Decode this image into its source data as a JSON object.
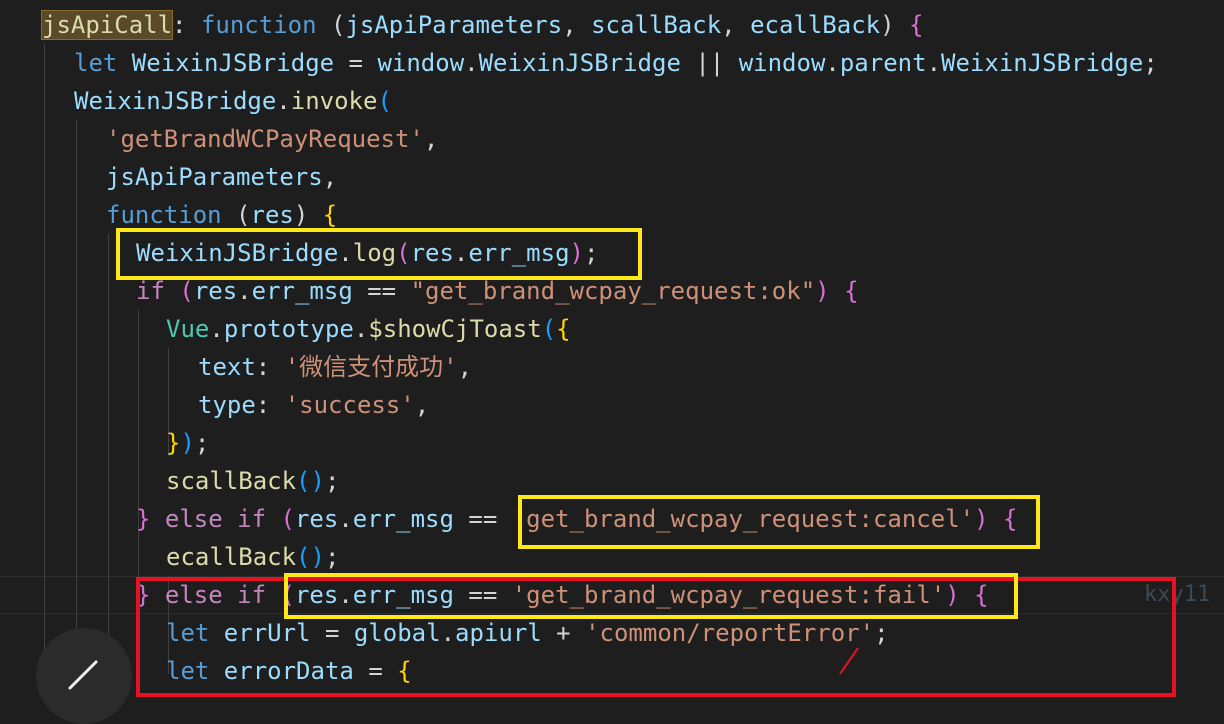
{
  "lines": [
    [
      {
        "t": "jsApiCall",
        "c": "#dcdcaa",
        "hl": true
      },
      {
        "t": ": ",
        "c": "#d4d4d4"
      },
      {
        "t": "function",
        "c": "#569cd6"
      },
      {
        "t": " (",
        "c": "#d4d4d4"
      },
      {
        "t": "jsApiParameters",
        "c": "#9cdcfe"
      },
      {
        "t": ", ",
        "c": "#d4d4d4"
      },
      {
        "t": "scallBack",
        "c": "#9cdcfe"
      },
      {
        "t": ", ",
        "c": "#d4d4d4"
      },
      {
        "t": "ecallBack",
        "c": "#9cdcfe"
      },
      {
        "t": ") ",
        "c": "#d4d4d4"
      },
      {
        "t": "{",
        "c": "#da70d6"
      }
    ],
    [
      {
        "t": "let",
        "c": "#569cd6"
      },
      {
        "t": " WeixinJSBridge ",
        "c": "#9cdcfe"
      },
      {
        "t": "= ",
        "c": "#d4d4d4"
      },
      {
        "t": "window",
        "c": "#9cdcfe"
      },
      {
        "t": ".",
        "c": "#d4d4d4"
      },
      {
        "t": "WeixinJSBridge",
        "c": "#9cdcfe"
      },
      {
        "t": " || ",
        "c": "#d4d4d4"
      },
      {
        "t": "window",
        "c": "#9cdcfe"
      },
      {
        "t": ".",
        "c": "#d4d4d4"
      },
      {
        "t": "parent",
        "c": "#9cdcfe"
      },
      {
        "t": ".",
        "c": "#d4d4d4"
      },
      {
        "t": "WeixinJSBridge",
        "c": "#9cdcfe"
      },
      {
        "t": ";",
        "c": "#d4d4d4"
      }
    ],
    [
      {
        "t": "WeixinJSBridge",
        "c": "#9cdcfe"
      },
      {
        "t": ".",
        "c": "#d4d4d4"
      },
      {
        "t": "invoke",
        "c": "#dcdcaa"
      },
      {
        "t": "(",
        "c": "#179fff"
      }
    ],
    [
      {
        "t": "'getBrandWCPayRequest'",
        "c": "#ce9178"
      },
      {
        "t": ",",
        "c": "#d4d4d4"
      }
    ],
    [
      {
        "t": "jsApiParameters",
        "c": "#9cdcfe"
      },
      {
        "t": ",",
        "c": "#d4d4d4"
      }
    ],
    [
      {
        "t": "function",
        "c": "#569cd6"
      },
      {
        "t": " (",
        "c": "#d4d4d4"
      },
      {
        "t": "res",
        "c": "#9cdcfe"
      },
      {
        "t": ") ",
        "c": "#d4d4d4"
      },
      {
        "t": "{",
        "c": "#ffd700"
      }
    ],
    [
      {
        "t": "WeixinJSBridge",
        "c": "#9cdcfe"
      },
      {
        "t": ".",
        "c": "#d4d4d4"
      },
      {
        "t": "log",
        "c": "#dcdcaa"
      },
      {
        "t": "(",
        "c": "#da70d6"
      },
      {
        "t": "res",
        "c": "#9cdcfe"
      },
      {
        "t": ".",
        "c": "#d4d4d4"
      },
      {
        "t": "err_msg",
        "c": "#9cdcfe"
      },
      {
        "t": ")",
        "c": "#da70d6"
      },
      {
        "t": ";",
        "c": "#d4d4d4"
      }
    ],
    [
      {
        "t": "if",
        "c": "#c586c0"
      },
      {
        "t": " (",
        "c": "#da70d6"
      },
      {
        "t": "res",
        "c": "#9cdcfe"
      },
      {
        "t": ".",
        "c": "#d4d4d4"
      },
      {
        "t": "err_msg",
        "c": "#9cdcfe"
      },
      {
        "t": " == ",
        "c": "#d4d4d4"
      },
      {
        "t": "\"get_brand_wcpay_request:ok\"",
        "c": "#ce9178"
      },
      {
        "t": ") ",
        "c": "#da70d6"
      },
      {
        "t": "{",
        "c": "#da70d6"
      }
    ],
    [
      {
        "t": "Vue",
        "c": "#4ec9b0"
      },
      {
        "t": ".",
        "c": "#d4d4d4"
      },
      {
        "t": "prototype",
        "c": "#9cdcfe"
      },
      {
        "t": ".",
        "c": "#d4d4d4"
      },
      {
        "t": "$showCjToast",
        "c": "#dcdcaa"
      },
      {
        "t": "(",
        "c": "#179fff"
      },
      {
        "t": "{",
        "c": "#ffd700"
      }
    ],
    [
      {
        "t": "text",
        "c": "#9cdcfe"
      },
      {
        "t": ": ",
        "c": "#d4d4d4"
      },
      {
        "t": "'微信支付成功'",
        "c": "#ce9178"
      },
      {
        "t": ",",
        "c": "#d4d4d4"
      }
    ],
    [
      {
        "t": "type",
        "c": "#9cdcfe"
      },
      {
        "t": ": ",
        "c": "#d4d4d4"
      },
      {
        "t": "'success'",
        "c": "#ce9178"
      },
      {
        "t": ",",
        "c": "#d4d4d4"
      }
    ],
    [
      {
        "t": "}",
        "c": "#ffd700"
      },
      {
        "t": ")",
        "c": "#179fff"
      },
      {
        "t": ";",
        "c": "#d4d4d4"
      }
    ],
    [
      {
        "t": "scallBack",
        "c": "#dcdcaa"
      },
      {
        "t": "()",
        "c": "#179fff"
      },
      {
        "t": ";",
        "c": "#d4d4d4"
      }
    ],
    [
      {
        "t": "}",
        "c": "#da70d6"
      },
      {
        "t": " else if ",
        "c": "#c586c0"
      },
      {
        "t": "(",
        "c": "#da70d6"
      },
      {
        "t": "res",
        "c": "#9cdcfe"
      },
      {
        "t": ".",
        "c": "#d4d4d4"
      },
      {
        "t": "err_msg",
        "c": "#9cdcfe"
      },
      {
        "t": " == ",
        "c": "#d4d4d4"
      },
      {
        "t": "'get_brand_wcpay_request:cancel'",
        "c": "#ce9178"
      },
      {
        "t": ")",
        "c": "#da70d6"
      },
      {
        "t": " ",
        "c": "#d4d4d4"
      },
      {
        "t": "{",
        "c": "#da70d6"
      }
    ],
    [
      {
        "t": "ecallBack",
        "c": "#dcdcaa"
      },
      {
        "t": "()",
        "c": "#179fff"
      },
      {
        "t": ";",
        "c": "#d4d4d4"
      }
    ],
    [
      {
        "t": "}",
        "c": "#da70d6"
      },
      {
        "t": " else if ",
        "c": "#c586c0"
      },
      {
        "t": "(",
        "c": "#da70d6"
      },
      {
        "t": "res",
        "c": "#9cdcfe"
      },
      {
        "t": ".",
        "c": "#d4d4d4"
      },
      {
        "t": "err_msg",
        "c": "#9cdcfe"
      },
      {
        "t": " == ",
        "c": "#d4d4d4"
      },
      {
        "t": "'get_brand_wcpay_request:fail'",
        "c": "#ce9178"
      },
      {
        "t": ")",
        "c": "#da70d6"
      },
      {
        "t": " ",
        "c": "#d4d4d4"
      },
      {
        "t": "{",
        "c": "#da70d6"
      }
    ],
    [
      {
        "t": "let",
        "c": "#569cd6"
      },
      {
        "t": " errUrl ",
        "c": "#9cdcfe"
      },
      {
        "t": "= ",
        "c": "#d4d4d4"
      },
      {
        "t": "global",
        "c": "#9cdcfe"
      },
      {
        "t": ".",
        "c": "#d4d4d4"
      },
      {
        "t": "apiurl",
        "c": "#9cdcfe"
      },
      {
        "t": " + ",
        "c": "#d4d4d4"
      },
      {
        "t": "'common/reportError'",
        "c": "#ce9178"
      },
      {
        "t": ";",
        "c": "#d4d4d4"
      }
    ],
    [
      {
        "t": "let",
        "c": "#569cd6"
      },
      {
        "t": " errorData ",
        "c": "#9cdcfe"
      },
      {
        "t": "= ",
        "c": "#d4d4d4"
      },
      {
        "t": "{",
        "c": "#ffd700"
      }
    ]
  ],
  "user_tag": "kxy11",
  "colors": {
    "background": "#1e1e1e",
    "box_yellow": "#ffe81a",
    "box_red": "#e81123"
  }
}
